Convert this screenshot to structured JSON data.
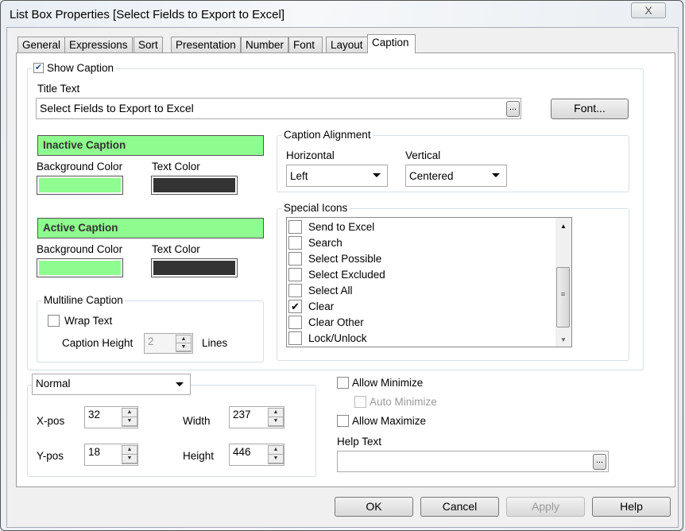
{
  "window": {
    "title": "List Box Properties [Select Fields to Export to Excel]",
    "close": "X"
  },
  "tabs": [
    "General",
    "Expressions",
    "Sort",
    "Presentation",
    "Number",
    "Font",
    "Layout",
    "Caption"
  ],
  "active_tab": "Caption",
  "show_caption": {
    "label": "Show Caption",
    "checked": true
  },
  "title_text": {
    "label": "Title Text",
    "value": "Select Fields to Export to Excel",
    "browse": "...",
    "font_button": "Font..."
  },
  "inactive": {
    "header": "Inactive Caption",
    "bg_label": "Background Color",
    "text_label": "Text Color",
    "bg_color": "#8efc8e",
    "text_color": "#333333"
  },
  "active": {
    "header": "Active Caption",
    "bg_label": "Background Color",
    "text_label": "Text Color",
    "bg_color": "#8efc8e",
    "text_color": "#333333"
  },
  "alignment": {
    "label": "Caption Alignment",
    "h_label": "Horizontal",
    "h_value": "Left",
    "v_label": "Vertical",
    "v_value": "Centered"
  },
  "special_icons": {
    "label": "Special Icons",
    "items": [
      {
        "label": "Send to Excel",
        "checked": false
      },
      {
        "label": "Search",
        "checked": false
      },
      {
        "label": "Select Possible",
        "checked": false
      },
      {
        "label": "Select Excluded",
        "checked": false
      },
      {
        "label": "Select All",
        "checked": false
      },
      {
        "label": "Clear",
        "checked": true
      },
      {
        "label": "Clear Other",
        "checked": false
      },
      {
        "label": "Lock/Unlock",
        "checked": false
      }
    ]
  },
  "multiline": {
    "label": "Multiline Caption",
    "wrap": "Wrap Text",
    "height_label": "Caption Height",
    "height_value": "2",
    "lines": "Lines"
  },
  "size": {
    "mode": "Normal",
    "xpos_label": "X-pos",
    "xpos": "32",
    "ypos_label": "Y-pos",
    "ypos": "18",
    "width_label": "Width",
    "width": "237",
    "height_label": "Height",
    "height": "446"
  },
  "options": {
    "allow_minimize": "Allow Minimize",
    "auto_minimize": "Auto Minimize",
    "allow_maximize": "Allow Maximize",
    "help_label": "Help Text",
    "help_value": "",
    "browse": "..."
  },
  "buttons": {
    "ok": "OK",
    "cancel": "Cancel",
    "apply": "Apply",
    "help": "Help"
  }
}
